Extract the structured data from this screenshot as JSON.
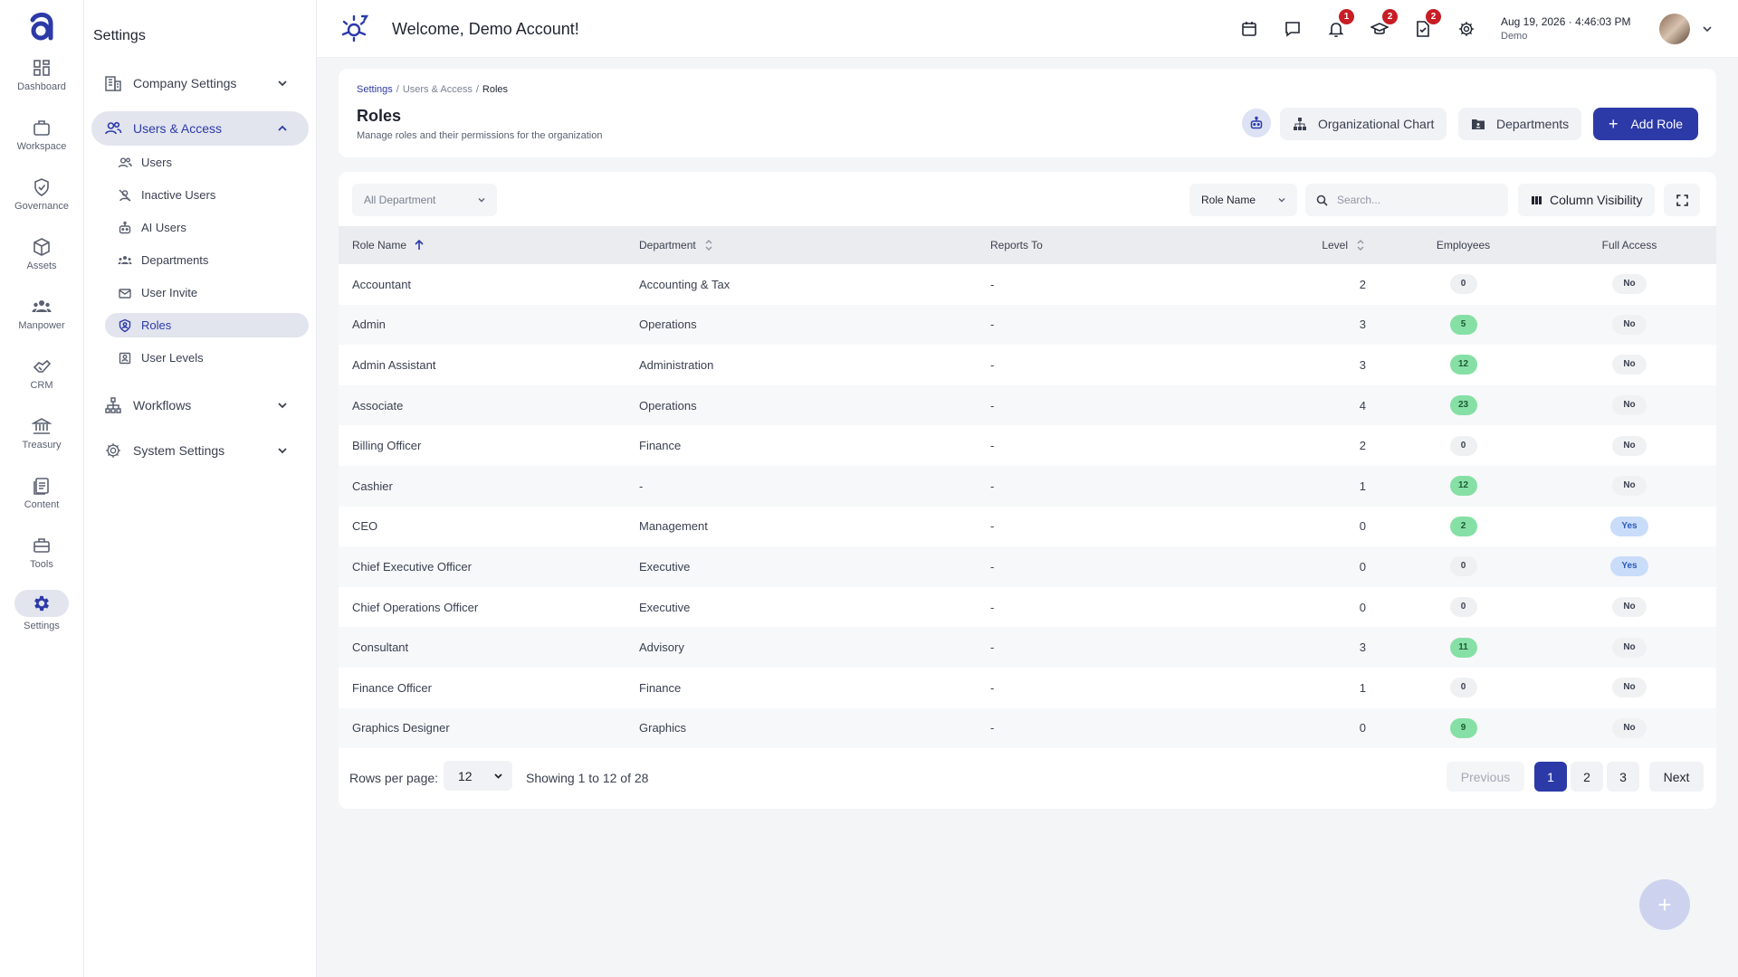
{
  "rail": {
    "items": [
      {
        "label": "Dashboard",
        "icon": "dashboard-icon"
      },
      {
        "label": "Workspace",
        "icon": "briefcase-icon"
      },
      {
        "label": "Governance",
        "icon": "shield-check-icon"
      },
      {
        "label": "Assets",
        "icon": "cube-icon"
      },
      {
        "label": "Manpower",
        "icon": "people-icon"
      },
      {
        "label": "CRM",
        "icon": "handshake-icon"
      },
      {
        "label": "Treasury",
        "icon": "bank-icon"
      },
      {
        "label": "Content",
        "icon": "document-icon"
      },
      {
        "label": "Tools",
        "icon": "toolbox-icon"
      },
      {
        "label": "Settings",
        "icon": "gear-icon"
      }
    ],
    "active": "Settings"
  },
  "sidebar": {
    "title": "Settings",
    "groups": [
      {
        "label": "Company Settings"
      },
      {
        "label": "Users & Access"
      },
      {
        "label": "Workflows"
      },
      {
        "label": "System Settings"
      }
    ],
    "users_access_items": [
      {
        "label": "Users"
      },
      {
        "label": "Inactive Users"
      },
      {
        "label": "AI Users"
      },
      {
        "label": "Departments"
      },
      {
        "label": "User Invite"
      },
      {
        "label": "Roles"
      },
      {
        "label": "User Levels"
      }
    ]
  },
  "topbar": {
    "welcome": "Welcome, Demo Account!",
    "badges": {
      "notifications": "1",
      "learning": "2",
      "tasks": "2"
    },
    "date": "Aug 19, 2026",
    "separator": "·",
    "time": "4:46:03 PM",
    "user": "Demo"
  },
  "header": {
    "breadcrumb": [
      "Settings",
      "Users & Access",
      "Roles"
    ],
    "breadcrumb_sep": "/",
    "title": "Roles",
    "subtitle": "Manage roles and their permissions for the organization",
    "org_chart_label": "Organizational Chart",
    "departments_label": "Departments",
    "add_role_label": "Add Role"
  },
  "filters": {
    "department_value": "All Department",
    "search_field": "Role Name",
    "search_placeholder": "Search...",
    "column_visibility_label": "Column Visibility"
  },
  "table": {
    "columns": [
      "Role Name",
      "Department",
      "Reports To",
      "Level",
      "Employees",
      "Full Access"
    ],
    "rows": [
      {
        "role": "Accountant",
        "department": "Accounting & Tax",
        "reports_to": "-",
        "level": "2",
        "employees": "0",
        "full_access": "No"
      },
      {
        "role": "Admin",
        "department": "Operations",
        "reports_to": "-",
        "level": "3",
        "employees": "5",
        "full_access": "No"
      },
      {
        "role": "Admin Assistant",
        "department": "Administration",
        "reports_to": "-",
        "level": "3",
        "employees": "12",
        "full_access": "No"
      },
      {
        "role": "Associate",
        "department": "Operations",
        "reports_to": "-",
        "level": "4",
        "employees": "23",
        "full_access": "No"
      },
      {
        "role": "Billing Officer",
        "department": "Finance",
        "reports_to": "-",
        "level": "2",
        "employees": "0",
        "full_access": "No"
      },
      {
        "role": "Cashier",
        "department": "-",
        "reports_to": "-",
        "level": "1",
        "employees": "12",
        "full_access": "No"
      },
      {
        "role": "CEO",
        "department": "Management",
        "reports_to": "-",
        "level": "0",
        "employees": "2",
        "full_access": "Yes"
      },
      {
        "role": "Chief Executive Officer",
        "department": "Executive",
        "reports_to": "-",
        "level": "0",
        "employees": "0",
        "full_access": "Yes"
      },
      {
        "role": "Chief Operations Officer",
        "department": "Executive",
        "reports_to": "-",
        "level": "0",
        "employees": "0",
        "full_access": "No"
      },
      {
        "role": "Consultant",
        "department": "Advisory",
        "reports_to": "-",
        "level": "3",
        "employees": "11",
        "full_access": "No"
      },
      {
        "role": "Finance Officer",
        "department": "Finance",
        "reports_to": "-",
        "level": "1",
        "employees": "0",
        "full_access": "No"
      },
      {
        "role": "Graphics Designer",
        "department": "Graphics",
        "reports_to": "-",
        "level": "0",
        "employees": "9",
        "full_access": "No"
      }
    ]
  },
  "pagination": {
    "rows_per_page_label": "Rows per page:",
    "rows_per_page_value": "12",
    "showing": "Showing 1 to 12 of 28",
    "previous": "Previous",
    "pages": [
      "1",
      "2",
      "3"
    ],
    "current_page": "1",
    "next": "Next"
  },
  "fab_label": "+",
  "colors": {
    "accent": "#2c3aa8",
    "badge": "#c81d25",
    "positive": "#86e0a6",
    "yes": "#c9dcfa"
  }
}
